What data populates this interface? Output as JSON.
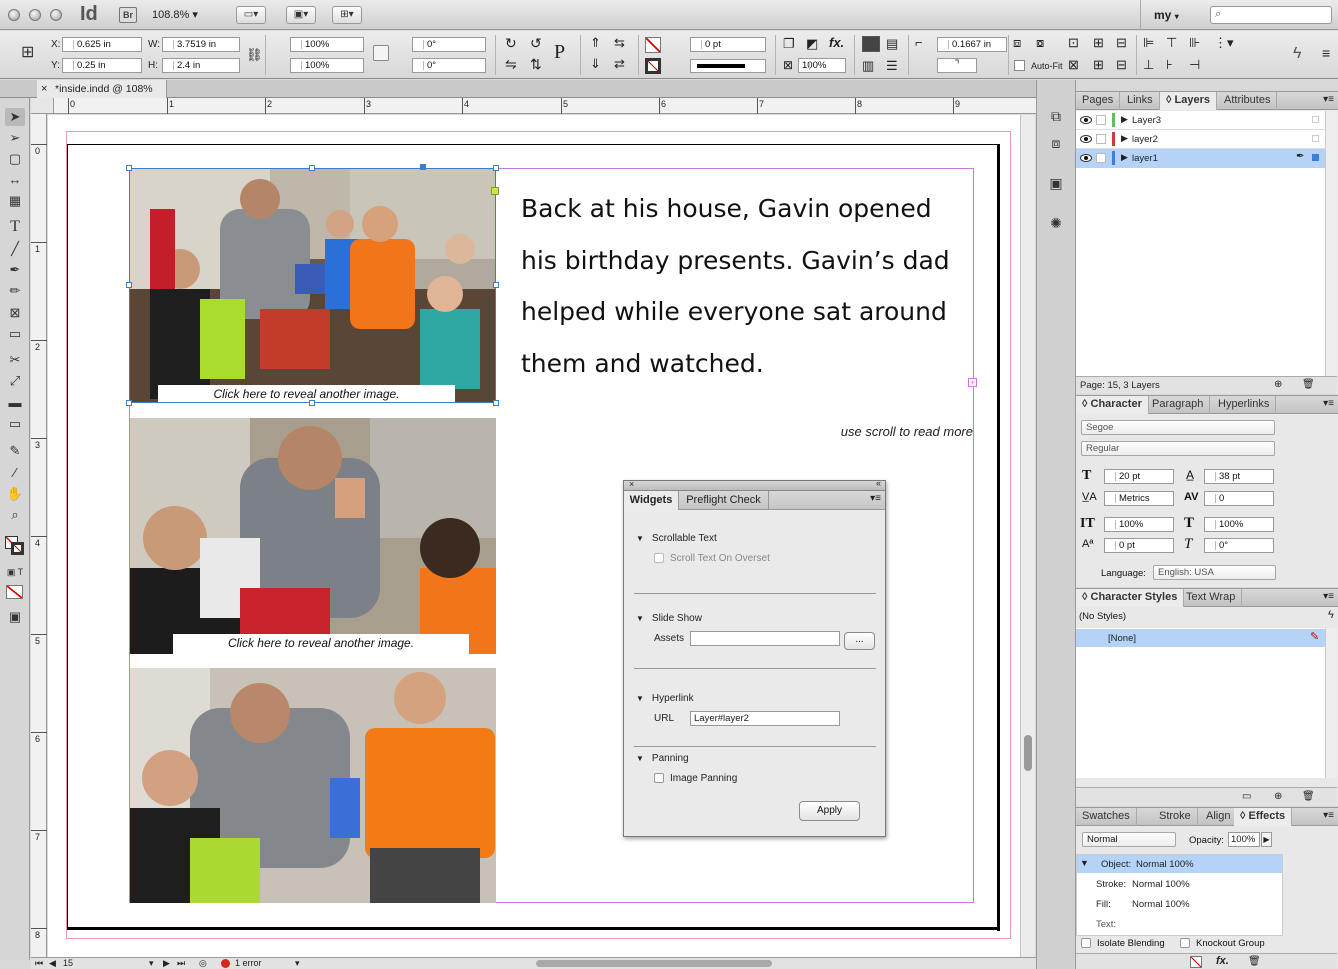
{
  "app": {
    "logo": "Id",
    "bridge": "Br",
    "zoom": "108.8%",
    "workspace": "my",
    "search_placeholder": ""
  },
  "control_panel": {
    "x_label": "X:",
    "x": "0.625 in",
    "y_label": "Y:",
    "y": "0.25 in",
    "w_label": "W:",
    "w": "3.7519 in",
    "h_label": "H:",
    "h": "2.4 in",
    "scale_x": "100%",
    "scale_y": "100%",
    "rotate": "0°",
    "shear": "0°",
    "stroke_weight": "0 pt",
    "opacity": "100%",
    "offset": "0.1667 in",
    "autofit": "Auto-Fit"
  },
  "document": {
    "tab_title": "*inside.indd @ 108%",
    "ruler_h": [
      "0",
      "1",
      "2",
      "3",
      "4",
      "5",
      "6",
      "7",
      "8",
      "9"
    ],
    "ruler_v": [
      "0",
      "1",
      "2",
      "3",
      "4",
      "5",
      "6",
      "7",
      "8"
    ],
    "body_text": "Back at his house, Gavin opened his birthday presents. Gavin’s dad helped while everyone sat around them and watched.",
    "caption1": "Click here to reveal another image.",
    "caption2": "Click here to reveal another image.",
    "scroll_note": "use scroll to read more"
  },
  "status_bar": {
    "page": "15",
    "errors": "1 error"
  },
  "layers_panel": {
    "tabs": [
      "Pages",
      "Links",
      "Layers",
      "Attributes"
    ],
    "active_tab": "Layers",
    "layers": [
      {
        "name": "Layer3",
        "color": "#5fbf5f"
      },
      {
        "name": "layer2",
        "color": "#d23a3a"
      },
      {
        "name": "layer1",
        "color": "#3f7fd8"
      }
    ],
    "footer": "Page: 15, 3 Layers"
  },
  "character_panel": {
    "tabs": [
      "Character",
      "Paragraph",
      "Hyperlinks"
    ],
    "font_family": "Segoe",
    "font_style": "Regular",
    "size": "20 pt",
    "leading": "38 pt",
    "kerning": "Metrics",
    "tracking": "0",
    "vscale": "100%",
    "hscale": "100%",
    "baseline": "0 pt",
    "skew": "0°",
    "language_label": "Language:",
    "language": "English: USA"
  },
  "character_styles_panel": {
    "tabs": [
      "Character Styles",
      "Text Wrap"
    ],
    "current": "(No Styles)",
    "items": [
      "[None]"
    ]
  },
  "effects_panel": {
    "tabs": [
      "Swatches",
      "Stroke",
      "Align",
      "Effects"
    ],
    "blend_mode": "Normal",
    "opacity_label": "Opacity:",
    "opacity": "100%",
    "rows": [
      {
        "label": "Object:",
        "value": "Normal 100%"
      },
      {
        "label": "Stroke:",
        "value": "Normal 100%"
      },
      {
        "label": "Fill:",
        "value": "Normal 100%"
      },
      {
        "label": "Text:",
        "value": ""
      }
    ],
    "isolate": "Isolate Blending",
    "knockout": "Knockout Group"
  },
  "widgets_dialog": {
    "tabs": [
      "Widgets",
      "Preflight Check"
    ],
    "sections": {
      "scrollable": "Scrollable Text",
      "scroll_overset": "Scroll Text On Overset",
      "slideshow": "Slide Show",
      "assets_label": "Assets",
      "assets_value": "",
      "browse": "...",
      "hyperlink": "Hyperlink",
      "url_label": "URL",
      "url_value": "Layer#layer2",
      "panning": "Panning",
      "image_panning": "Image Panning"
    },
    "apply": "Apply"
  },
  "colors": {
    "selection": "#3b7ec8",
    "margin_guide": "#c77ad8",
    "bleed_guide": "#e89bb2",
    "highlight_row": "#b4d3f7"
  }
}
